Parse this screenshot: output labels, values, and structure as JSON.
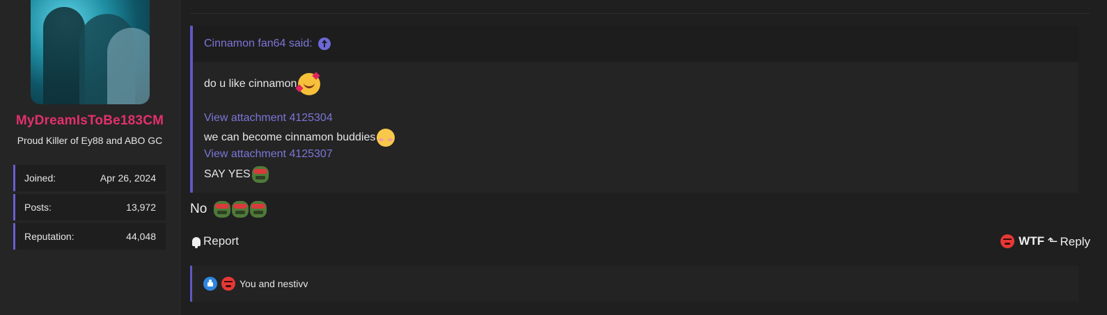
{
  "user": {
    "username": "MyDreamIsToBe183CM",
    "title": "Proud Killer of Ey88 and ABO GC",
    "stats": [
      {
        "label": "Joined:",
        "value": "Apr 26, 2024"
      },
      {
        "label": "Posts:",
        "value": "13,972"
      },
      {
        "label": "Reputation:",
        "value": "44,048"
      }
    ]
  },
  "quote": {
    "author_said": "Cinnamon fan64 said:",
    "line1": "do u like cinnamon",
    "attachment1": "View attachment 4125304",
    "line2": "we can become cinnamon buddies",
    "attachment2": "View attachment 4125307",
    "line3": "SAY YES"
  },
  "post": {
    "reply_text": "No"
  },
  "actions": {
    "report": "Report",
    "wtf": "WTF",
    "reply": "Reply"
  },
  "reactions": {
    "summary": "You and nestivv"
  },
  "colors": {
    "accent": "#5f58c4",
    "link": "#7b76d8",
    "username": "#e3306d"
  }
}
